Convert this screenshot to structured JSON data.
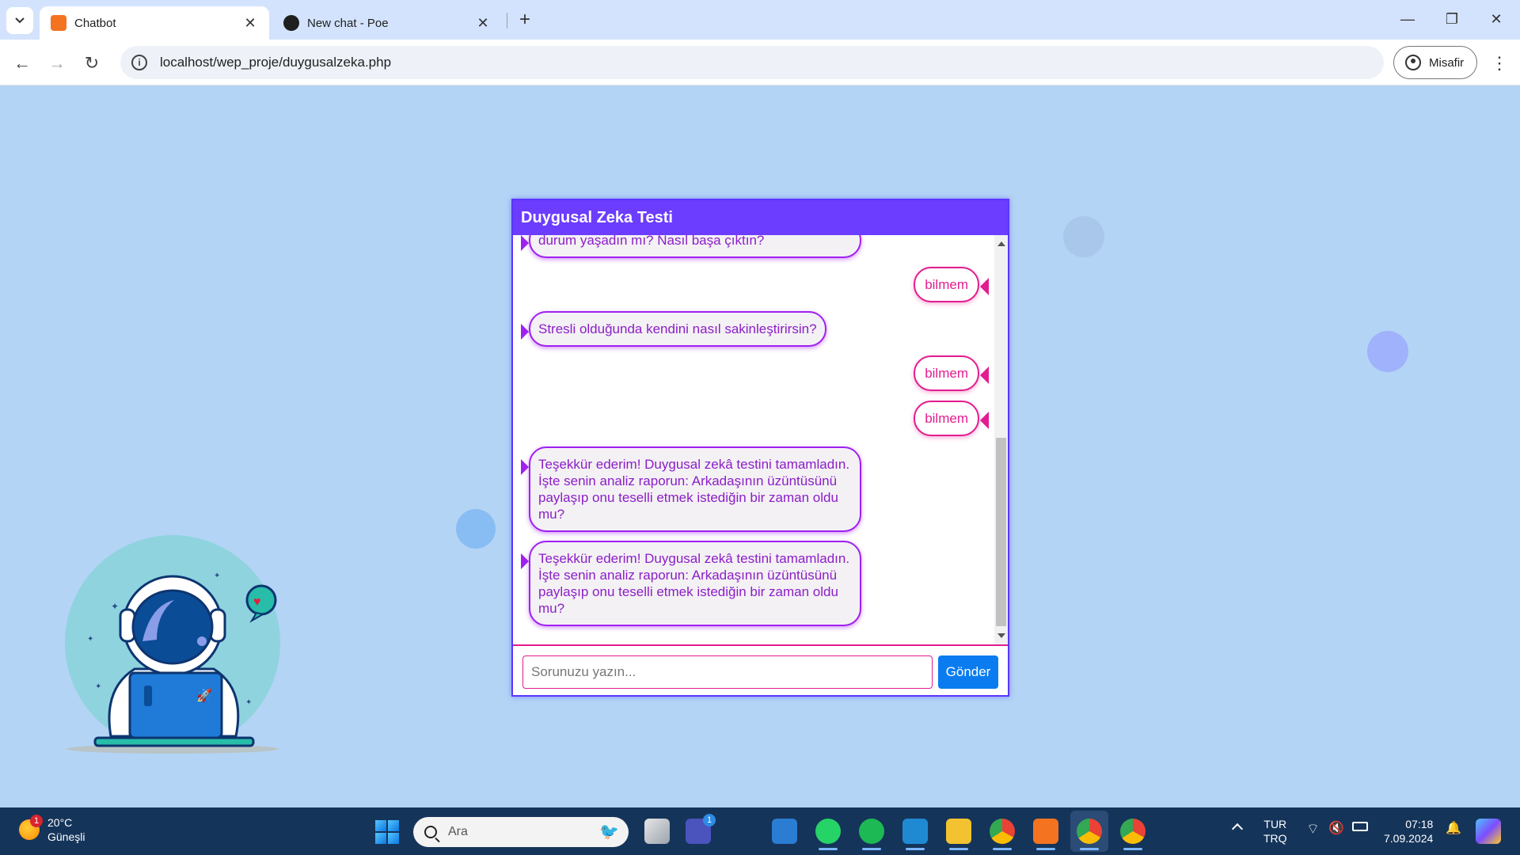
{
  "browser": {
    "tabs": [
      {
        "title": "Chatbot",
        "active": true
      },
      {
        "title": "New chat - Poe",
        "active": false
      }
    ],
    "url": "localhost/wep_proje/duygusalzeka.php",
    "profile_label": "Misafir"
  },
  "chat": {
    "title": "Duygusal Zeka Testi",
    "messages": [
      {
        "sender": "bot",
        "text": "durum yaşadın mı? Nasıl başa çıktın?"
      },
      {
        "sender": "user",
        "text": "bilmem"
      },
      {
        "sender": "bot",
        "text": "Stresli olduğunda kendini nasıl sakinleştirirsin?"
      },
      {
        "sender": "user",
        "text": "bilmem"
      },
      {
        "sender": "user",
        "text": "bilmem"
      },
      {
        "sender": "bot",
        "text": "Teşekkür ederim! Duygusal zekâ testini tamamladın. İşte senin analiz raporun: Arkadaşının üzüntüsünü paylaşıp onu teselli etmek istediğin bir zaman oldu mu?"
      },
      {
        "sender": "bot",
        "text": "Teşekkür ederim! Duygusal zekâ testini tamamladın. İşte senin analiz raporun: Arkadaşının üzüntüsünü paylaşıp onu teselli etmek istediğin bir zaman oldu mu?"
      }
    ],
    "input_placeholder": "Sorunuzu yazın...",
    "send_label": "Gönder"
  },
  "taskbar": {
    "weather": {
      "temp": "20°C",
      "condition": "Güneşli",
      "badge": "1"
    },
    "search_placeholder": "Ara",
    "teams_badge": "1",
    "language": {
      "line1": "TUR",
      "line2": "TRQ"
    },
    "time": "07:18",
    "date": "7.09.2024"
  },
  "colors": {
    "page_bg": "#b3d4f5",
    "chat_header": "#6c3cff",
    "bot_text": "#8b1ec8",
    "user_text": "#e21d8f",
    "send_button": "#0a7cf0",
    "taskbar": "#15345a"
  }
}
